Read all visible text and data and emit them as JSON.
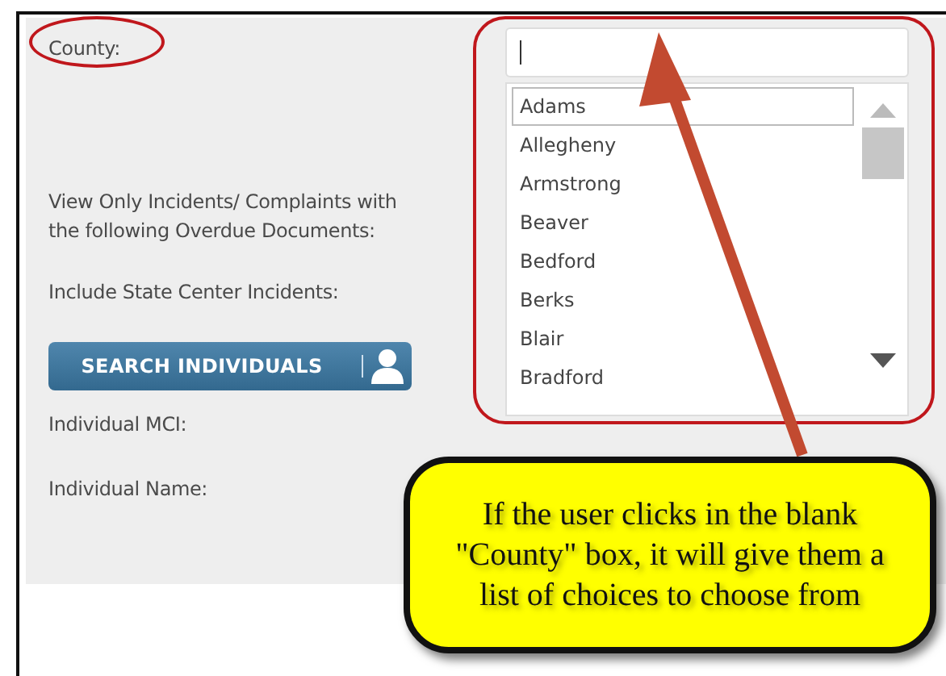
{
  "form": {
    "county_label": "County:",
    "county_input": {
      "focused": true
    },
    "county_options": [
      {
        "label": "Adams",
        "selected": true
      },
      {
        "label": "Allegheny",
        "selected": false
      },
      {
        "label": "Armstrong",
        "selected": false
      },
      {
        "label": "Beaver",
        "selected": false
      },
      {
        "label": "Bedford",
        "selected": false
      },
      {
        "label": "Berks",
        "selected": false
      },
      {
        "label": "Blair",
        "selected": false
      },
      {
        "label": "Bradford",
        "selected": false
      }
    ],
    "overdue_label": "View Only Incidents/ Complaints with the following Overdue Documents:",
    "state_center_label": "Include State Center Incidents:",
    "search_button": "SEARCH INDIVIDUALS",
    "mci_label": "Individual MCI:",
    "name_label": "Individual Name:"
  },
  "callout": {
    "text": "If the user clicks in the blank \"County\" box, it will give them a list of choices to choose from"
  }
}
